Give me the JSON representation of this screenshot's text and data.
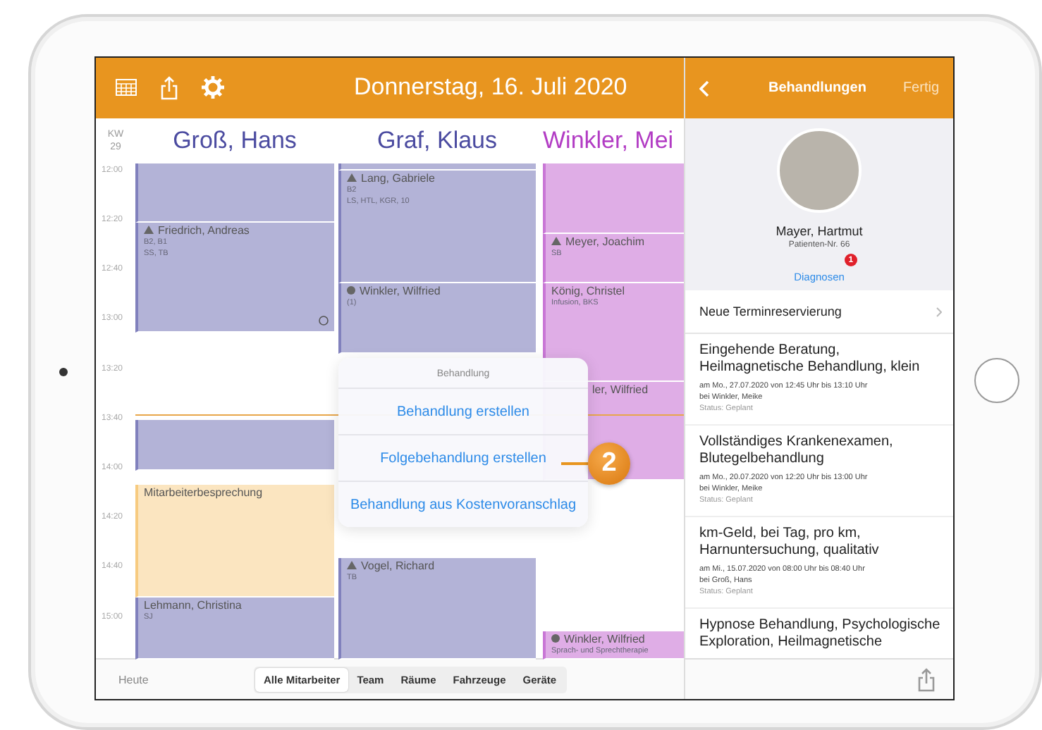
{
  "calendar": {
    "title": "Donnerstag, 16. Juli 2020",
    "week_label": "KW",
    "week": "29",
    "times": [
      "12:00",
      "12:20",
      "12:40",
      "13:00",
      "13:20",
      "13:40",
      "14:00",
      "14:20",
      "14:40",
      "15:00"
    ],
    "columns": [
      {
        "name": "Groß, Hans",
        "color": "#4b4ba0",
        "events": [
          {
            "kind": "empty",
            "marker": false
          },
          {
            "kind": "alert",
            "name": "Friedrich, Andreas",
            "lines": [
              "B2, B1",
              "SS, TB"
            ],
            "marker": true
          },
          {
            "kind": "empty",
            "marker": false
          },
          {
            "kind": "meeting",
            "name": "Mitarbeiterbesprechung",
            "marker": false
          },
          {
            "kind": "plain",
            "name": "Lehmann, Christina",
            "lines": [
              "SJ"
            ],
            "marker": false
          }
        ]
      },
      {
        "name": "Graf, Klaus",
        "color": "#4b4ba0",
        "events": [
          {
            "kind": "empty",
            "marker": false
          },
          {
            "kind": "alert",
            "name": "Lang, Gabriele",
            "lines": [
              "B2",
              "LS, HTL, KGR, 10"
            ],
            "marker": false
          },
          {
            "kind": "info",
            "name": "Winkler, Wilfried",
            "lines": [
              "(1)"
            ],
            "marker": false
          },
          {
            "kind": "alert",
            "name": "Vogel, Richard",
            "lines": [
              "TB"
            ],
            "marker": false
          }
        ]
      },
      {
        "name": "Winkler, Mei",
        "color": "#b23cc4",
        "events": [
          {
            "kind": "empty",
            "marker": false
          },
          {
            "kind": "alert",
            "name": "Meyer, Joachim",
            "lines": [
              "SB"
            ],
            "marker": false
          },
          {
            "kind": "plain",
            "name": "König, Christel",
            "lines": [
              "Infusion, BKS"
            ],
            "marker": false
          },
          {
            "kind": "covered",
            "name": "ler, Wilfried",
            "marker": false
          },
          {
            "kind": "info",
            "name": "Winkler, Wilfried",
            "lines": [
              "Sprach- und Sprechtherapie"
            ],
            "marker": false
          }
        ]
      }
    ],
    "popover": {
      "title": "Behandlung",
      "actions": [
        "Behandlung erstellen",
        "Folgebehandlung erstellen",
        "Behandlung aus Kostenvoranschlag"
      ]
    },
    "callout": "2",
    "today": "Heute",
    "filters": [
      {
        "label": "Alle Mitarbeiter",
        "selected": true
      },
      {
        "label": "Team",
        "selected": false
      },
      {
        "label": "Räume",
        "selected": false
      },
      {
        "label": "Fahrzeuge",
        "selected": false
      },
      {
        "label": "Geräte",
        "selected": false
      }
    ]
  },
  "panel": {
    "title": "Behandlungen",
    "done": "Fertig",
    "patient": "Mayer, Hartmut",
    "patient_no": "Patienten-Nr. 66",
    "diagnoses": "Diagnosen",
    "diagnoses_badge": "1",
    "new_booking": "Neue Terminreservierung",
    "treatments": [
      {
        "title": "Eingehende Beratung, Heilmagnetische Behandlung, klein",
        "date": "am Mo., 27.07.2020 von 12:45 Uhr bis 13:10 Uhr",
        "by": "bei Winkler, Meike",
        "status": "Status: Geplant"
      },
      {
        "title": "Vollständiges Krankenexamen, Blutegelbehandlung",
        "date": "am Mo., 20.07.2020 von 12:20 Uhr bis 13:00 Uhr",
        "by": "bei Winkler, Meike",
        "status": "Status: Geplant"
      },
      {
        "title": "km-Geld, bei Tag, pro km, Harnuntersuchung, qualitativ",
        "date": "am Mi., 15.07.2020 von 08:00 Uhr bis 08:40 Uhr",
        "by": "bei Groß, Hans",
        "status": "Status: Geplant"
      },
      {
        "title": "Hypnose Behandlung, Psychologische Exploration, Heilmagnetische"
      }
    ]
  }
}
